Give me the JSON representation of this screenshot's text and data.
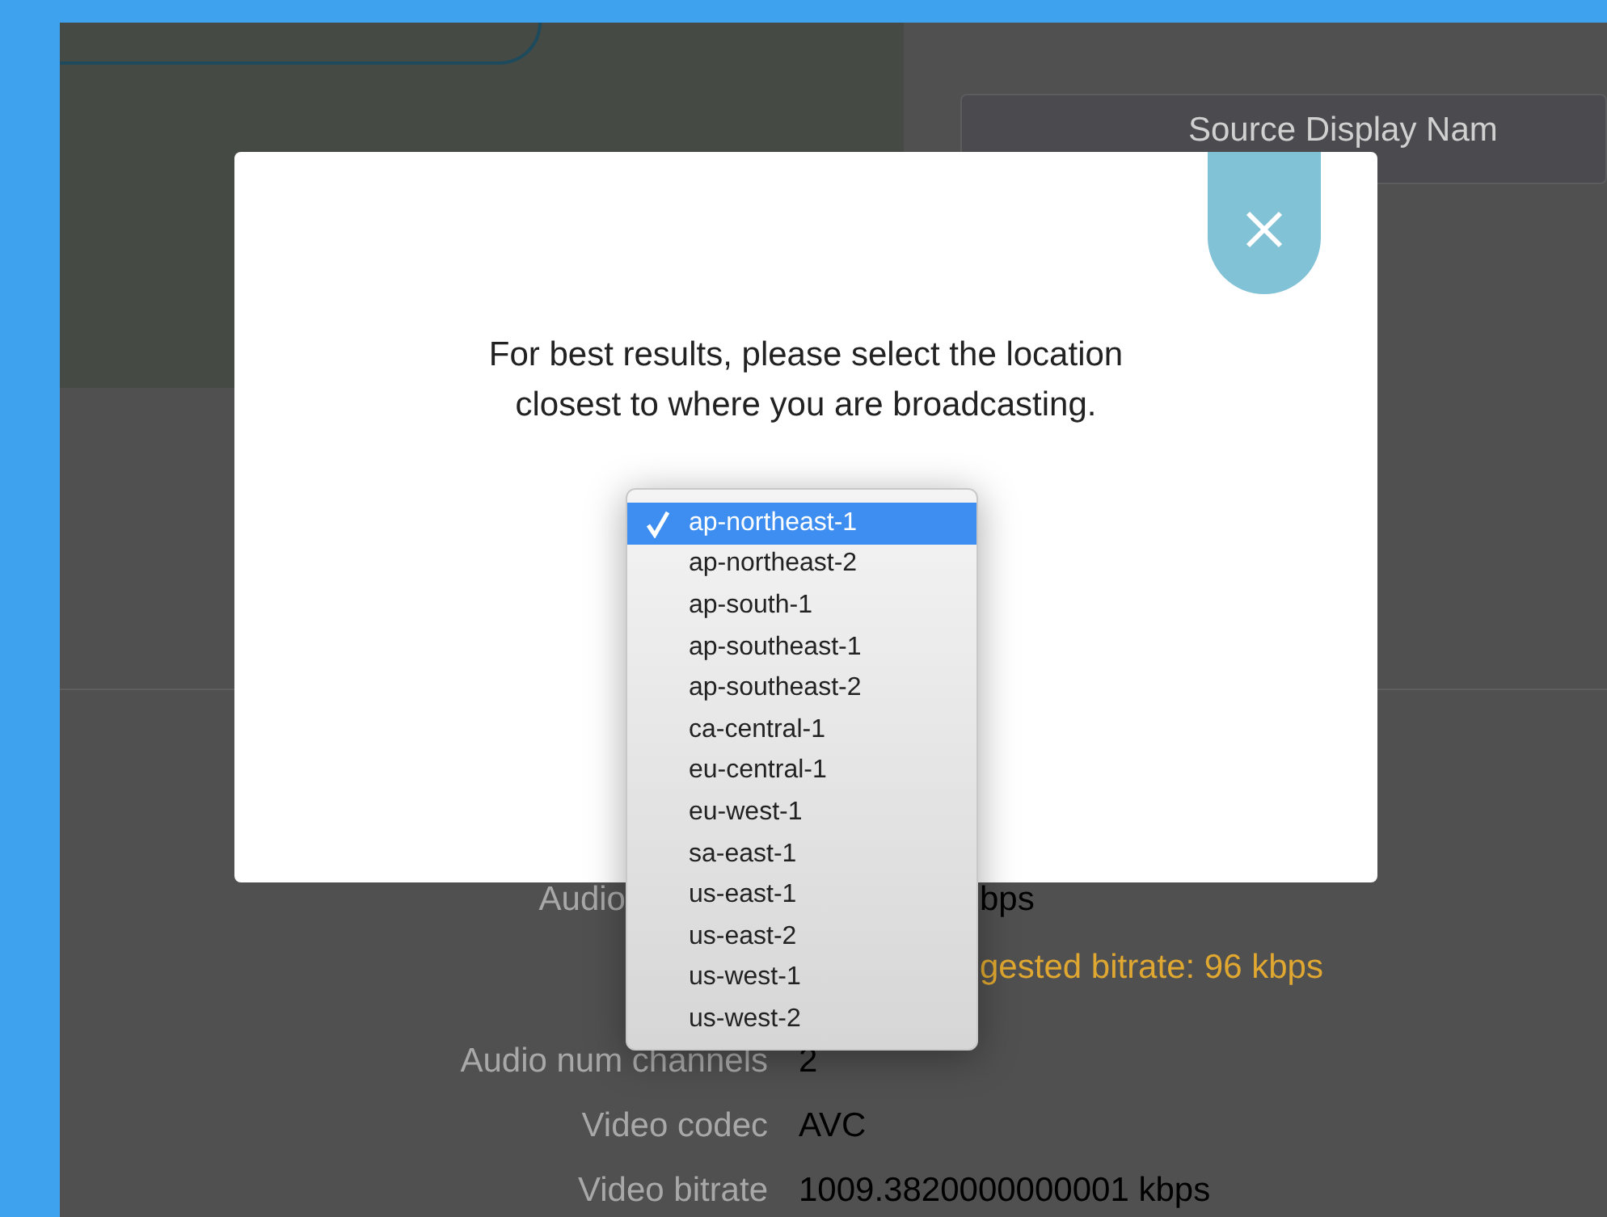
{
  "background": {
    "source_button": "Source Display Nam",
    "rows": [
      {
        "kind": "partial",
        "label": "Audio",
        "value": "bps"
      },
      {
        "kind": "warning",
        "value": "gested bitrate: 96 kbps"
      },
      {
        "kind": "plain",
        "label": "Audio num channels",
        "value": "2"
      },
      {
        "kind": "plain",
        "label": "Video codec",
        "value": "AVC"
      },
      {
        "kind": "plain",
        "label": "Video bitrate",
        "value": "1009.3820000000001 kbps"
      }
    ]
  },
  "modal": {
    "message_lines": [
      "For best results, please select the location",
      "closest to where you are broadcasting."
    ],
    "location_options": [
      {
        "label": "ap-northeast-1",
        "selected": true
      },
      {
        "label": "ap-northeast-2",
        "selected": false
      },
      {
        "label": "ap-south-1",
        "selected": false
      },
      {
        "label": "ap-southeast-1",
        "selected": false
      },
      {
        "label": "ap-southeast-2",
        "selected": false
      },
      {
        "label": "ca-central-1",
        "selected": false
      },
      {
        "label": "eu-central-1",
        "selected": false
      },
      {
        "label": "eu-west-1",
        "selected": false
      },
      {
        "label": "sa-east-1",
        "selected": false
      },
      {
        "label": "us-east-1",
        "selected": false
      },
      {
        "label": "us-east-2",
        "selected": false
      },
      {
        "label": "us-west-1",
        "selected": false
      },
      {
        "label": "us-west-2",
        "selected": false
      }
    ]
  }
}
